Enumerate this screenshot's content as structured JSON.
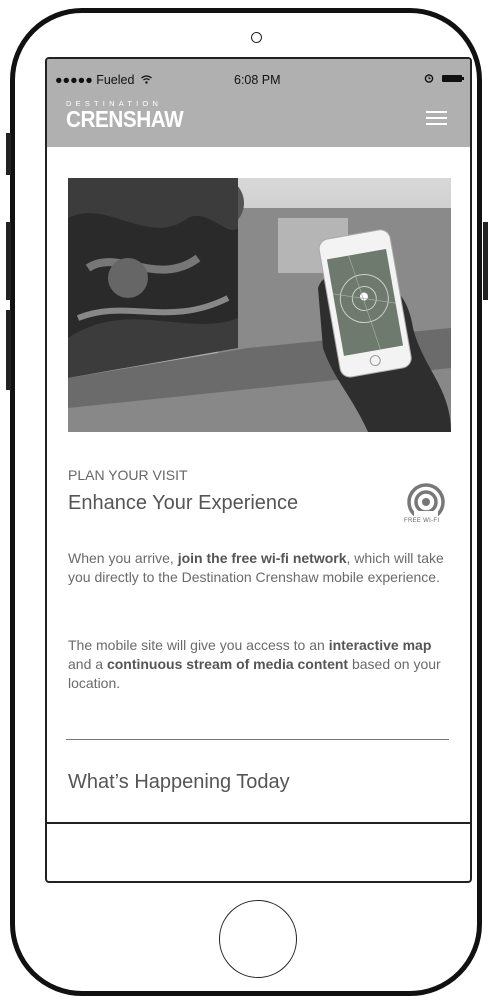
{
  "status_bar": {
    "carrier": "●●●●● Fueled",
    "time": "6:08 PM"
  },
  "header": {
    "logo_small": "DESTINATION",
    "logo_big": "CRENSHAW"
  },
  "content": {
    "eyebrow": "PLAN YOUR VISIT",
    "title": "Enhance Your Experience",
    "wifi_label": "FREE WI-FI",
    "p1_a": "When you arrive, ",
    "p1_b": "join the free wi-fi network",
    "p1_c": ", which will take you directly to the Destination Crenshaw mobile experience.",
    "p2_a": "The mobile site will give you access to an ",
    "p2_b": "interactive map",
    "p2_c": " and a ",
    "p2_d": "continuous stream of media content",
    "p2_e": " based on your location.",
    "section_title": "What’s Happening Today"
  }
}
